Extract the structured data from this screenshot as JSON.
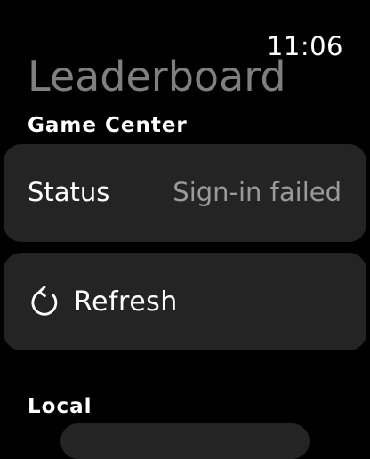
{
  "status_bar": {
    "time": "11:06"
  },
  "page": {
    "title": "Leaderboard"
  },
  "sections": {
    "game_center": {
      "header": "Game Center",
      "status": {
        "label": "Status",
        "value": "Sign-in failed"
      },
      "refresh": {
        "label": "Refresh",
        "icon": "refresh-icon"
      }
    },
    "local": {
      "header": "Local"
    }
  },
  "colors": {
    "background": "#000000",
    "card": "#242424",
    "title": "#7f7f7f",
    "secondary_text": "#9a9a9a",
    "primary_text": "#ffffff"
  }
}
